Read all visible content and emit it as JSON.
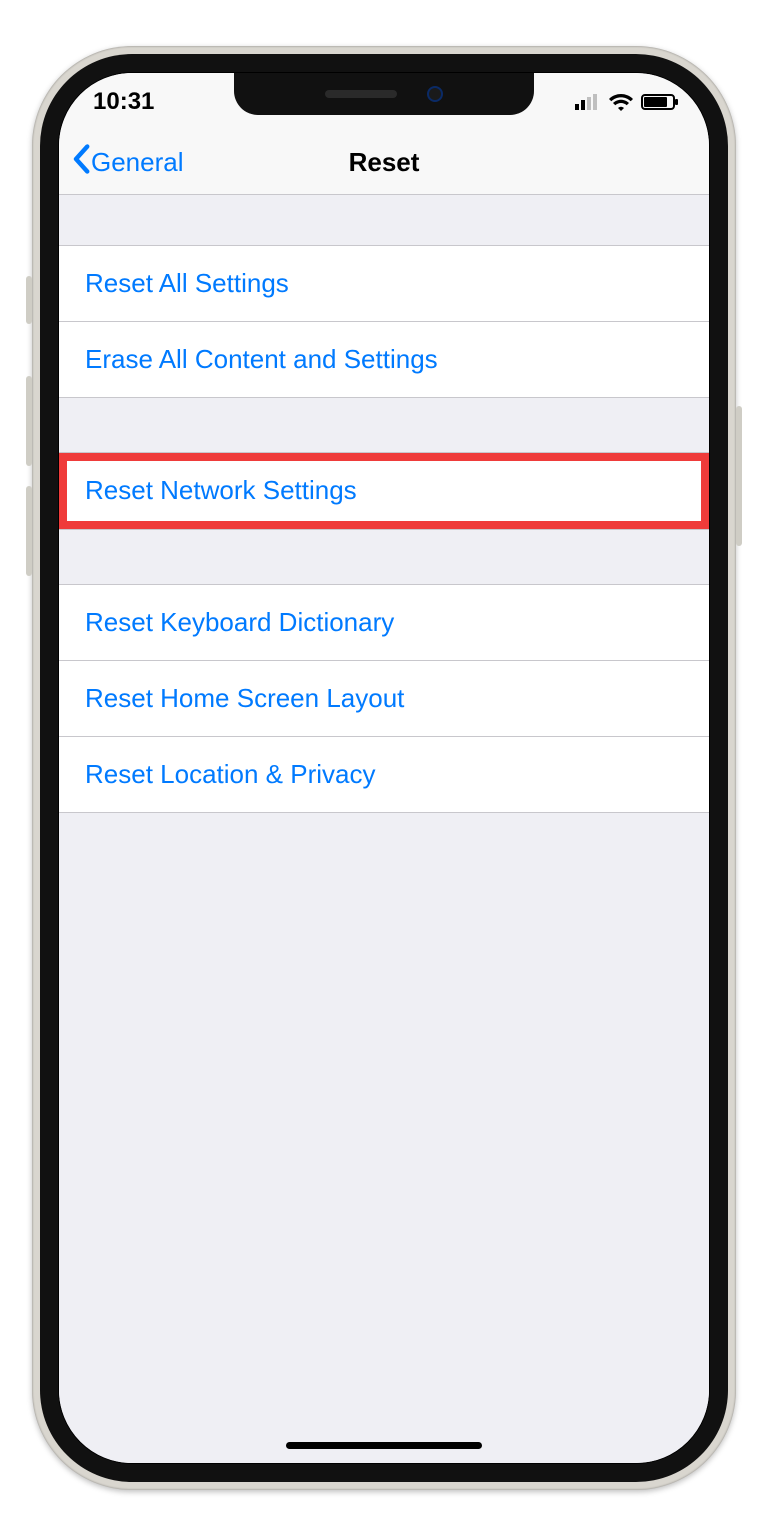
{
  "statusbar": {
    "time": "10:31"
  },
  "nav": {
    "back_label": "General",
    "title": "Reset"
  },
  "groups": {
    "g1": {
      "reset_all": "Reset All Settings",
      "erase_all": "Erase All Content and Settings"
    },
    "g2": {
      "reset_network": "Reset Network Settings"
    },
    "g3": {
      "reset_keyboard": "Reset Keyboard Dictionary",
      "reset_home": "Reset Home Screen Layout",
      "reset_location": "Reset Location & Privacy"
    }
  },
  "highlight_color": "#ef3b3a",
  "accent_color": "#007aff"
}
